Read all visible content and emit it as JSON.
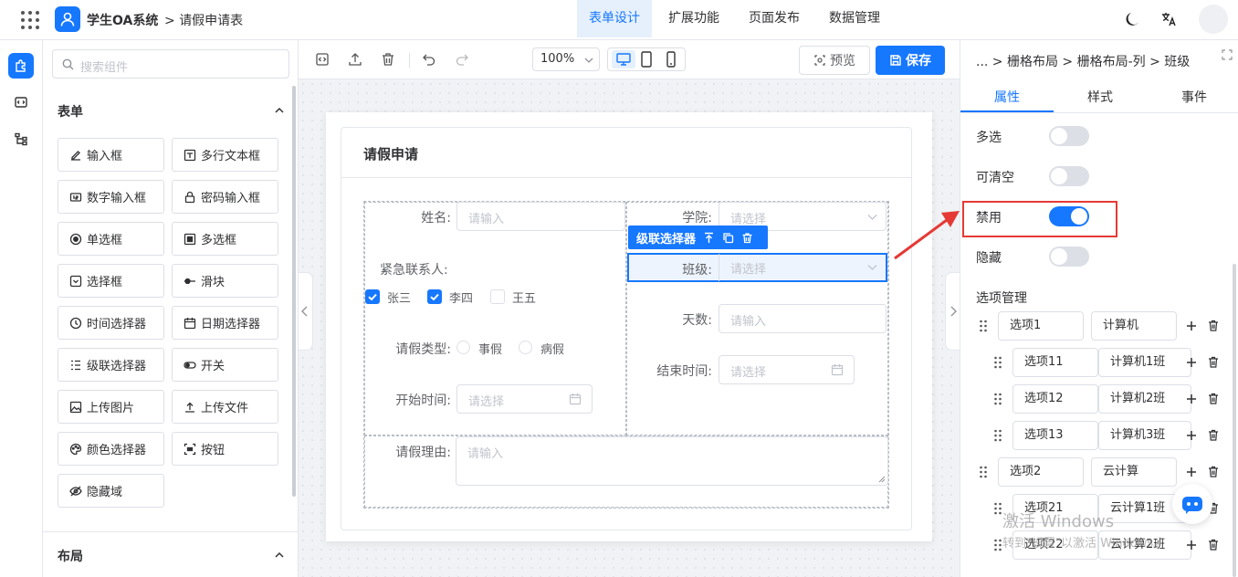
{
  "header": {
    "app_name": "学生OA系统",
    "breadcrumb": "请假申请表",
    "nav": [
      "表单设计",
      "扩展功能",
      "页面发布",
      "数据管理"
    ],
    "active_nav": "表单设计"
  },
  "palette": {
    "search_placeholder": "搜索组件",
    "form_section": "表单",
    "layout_section": "布局",
    "components": [
      {
        "label": "输入框",
        "icon": "edit-icon"
      },
      {
        "label": "多行文本框",
        "icon": "textarea-icon"
      },
      {
        "label": "数字输入框",
        "icon": "number-input-icon"
      },
      {
        "label": "密码输入框",
        "icon": "lock-icon"
      },
      {
        "label": "单选框",
        "icon": "radio-icon"
      },
      {
        "label": "多选框",
        "icon": "checkbox-icon"
      },
      {
        "label": "选择框",
        "icon": "select-icon"
      },
      {
        "label": "滑块",
        "icon": "slider-icon"
      },
      {
        "label": "时间选择器",
        "icon": "clock-icon"
      },
      {
        "label": "日期选择器",
        "icon": "calendar-icon"
      },
      {
        "label": "级联选择器",
        "icon": "cascader-icon"
      },
      {
        "label": "开关",
        "icon": "switch-icon"
      },
      {
        "label": "上传图片",
        "icon": "image-icon"
      },
      {
        "label": "上传文件",
        "icon": "upload-icon"
      },
      {
        "label": "颜色选择器",
        "icon": "palette-icon"
      },
      {
        "label": "按钮",
        "icon": "button-icon"
      },
      {
        "label": "隐藏域",
        "icon": "eye-off-icon"
      }
    ]
  },
  "toolbar": {
    "zoom": "100%",
    "preview": "预览",
    "save": "保存"
  },
  "form": {
    "title": "请假申请",
    "name_label": "姓名:",
    "name_placeholder": "请输入",
    "college_label": "学院:",
    "college_placeholder": "请选择",
    "selected_component": "级联选择器",
    "class_label": "班级:",
    "class_placeholder": "请选择",
    "contact_label": "紧急联系人:",
    "contacts": [
      {
        "label": "张三",
        "checked": true
      },
      {
        "label": "李四",
        "checked": true
      },
      {
        "label": "王五",
        "checked": false
      }
    ],
    "days_label": "天数:",
    "days_placeholder": "请输入",
    "leave_type_label": "请假类型:",
    "leave_types": [
      "事假",
      "病假"
    ],
    "end_time_label": "结束时间:",
    "end_time_placeholder": "请选择",
    "start_time_label": "开始时间:",
    "start_time_placeholder": "请选择",
    "reason_label": "请假理由:",
    "reason_placeholder": "请输入"
  },
  "props": {
    "breadcrumb": "... > 栅格布局 > 栅格布局-列 > 班级",
    "tabs": [
      "属性",
      "样式",
      "事件"
    ],
    "active_tab": "属性",
    "switches": [
      {
        "label": "多选",
        "on": false
      },
      {
        "label": "可清空",
        "on": false
      },
      {
        "label": "禁用",
        "on": true
      },
      {
        "label": "隐藏",
        "on": false
      }
    ],
    "options_title": "选项管理",
    "options": [
      {
        "value": "选项1",
        "label": "计算机",
        "level": 0
      },
      {
        "value": "选项11",
        "label": "计算机1班",
        "level": 1
      },
      {
        "value": "选项12",
        "label": "计算机2班",
        "level": 1
      },
      {
        "value": "选项13",
        "label": "计算机3班",
        "level": 1
      },
      {
        "value": "选项2",
        "label": "云计算",
        "level": 0
      },
      {
        "value": "选项21",
        "label": "云计算1班",
        "level": 1
      },
      {
        "value": "选项22",
        "label": "云计算2班",
        "level": 1
      }
    ]
  },
  "watermark": {
    "line1": "激活 Windows",
    "line2": "转到\"设置\"以激活 Windows。"
  },
  "colors": {
    "accent": "#1677ff",
    "highlight": "#e53935"
  }
}
